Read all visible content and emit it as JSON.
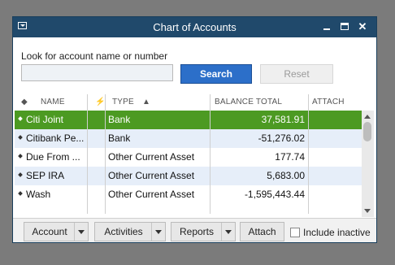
{
  "window": {
    "title": "Chart of Accounts"
  },
  "search": {
    "label": "Look for account name or number",
    "value": "",
    "search_button": "Search",
    "reset_button": "Reset"
  },
  "table": {
    "headers": {
      "name": "NAME",
      "type": "TYPE",
      "balance": "BALANCE TOTAL",
      "attach": "ATTACH"
    },
    "rows": [
      {
        "name": "Citi Joint",
        "type": "Bank",
        "balance": "37,581.91",
        "selected": true
      },
      {
        "name": "Citibank Pe...",
        "type": "Bank",
        "balance": "-51,276.02"
      },
      {
        "name": "Due From ...",
        "type": "Other Current Asset",
        "balance": "177.74"
      },
      {
        "name": "SEP IRA",
        "type": "Other Current Asset",
        "balance": "5,683.00"
      },
      {
        "name": "Wash",
        "type": "Other Current Asset",
        "balance": "-1,595,443.44"
      }
    ]
  },
  "footer": {
    "account": "Account",
    "activities": "Activities",
    "reports": "Reports",
    "attach": "Attach",
    "include_inactive": "Include inactive"
  },
  "icons": [
    "window-menu-icon",
    "minimize-icon",
    "maximize-icon",
    "close-icon",
    "sort-diamond-icon",
    "lightning-icon",
    "sort-up-icon",
    "dropdown-arrow-icon",
    "checkbox-icon"
  ],
  "colors": {
    "titlebar": "#20496b",
    "selected_row": "#4c9a22",
    "alt_row": "#e6eef9",
    "search_button": "#2c6fc9"
  }
}
